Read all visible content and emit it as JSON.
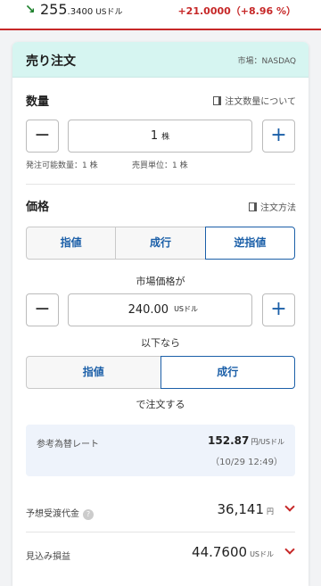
{
  "ticker": {
    "price_main": "255",
    "price_dec": ".3400",
    "price_unit": "USドル",
    "change": "+21.0000（+8.96 %）"
  },
  "order": {
    "title": "売り注文",
    "market": "市場：NASDAQ"
  },
  "quantity": {
    "label": "数量",
    "help": "注文数量について",
    "value": "1",
    "unit": "株",
    "available": "発注可能数量：1 株",
    "lot": "売買単位：1 株"
  },
  "price": {
    "label": "価格",
    "help": "注文方法",
    "tabs": [
      "指値",
      "成行",
      "逆指値"
    ],
    "active_tab": "逆指値",
    "trigger_prefix": "市場価格が",
    "trigger_value": "240.00",
    "trigger_unit": "USドル",
    "trigger_suffix": "以下なら",
    "exec_tabs": [
      "指値",
      "成行"
    ],
    "active_exec": "成行",
    "exec_suffix": "で注文する"
  },
  "rate": {
    "label": "参考為替レート",
    "value": "152.87",
    "unit": "円/USドル",
    "timestamp": "（10/29  12:49）"
  },
  "summary": {
    "proceeds_label": "予想受渡代金",
    "proceeds_value": "36,141",
    "proceeds_unit": "円",
    "pnl_label": "見込み損益",
    "pnl_value": "44.7600",
    "pnl_unit": "USドル"
  },
  "colors": {
    "accent": "#1b5fa8",
    "negative": "#c62828",
    "header_bg": "#d6f5f1"
  }
}
